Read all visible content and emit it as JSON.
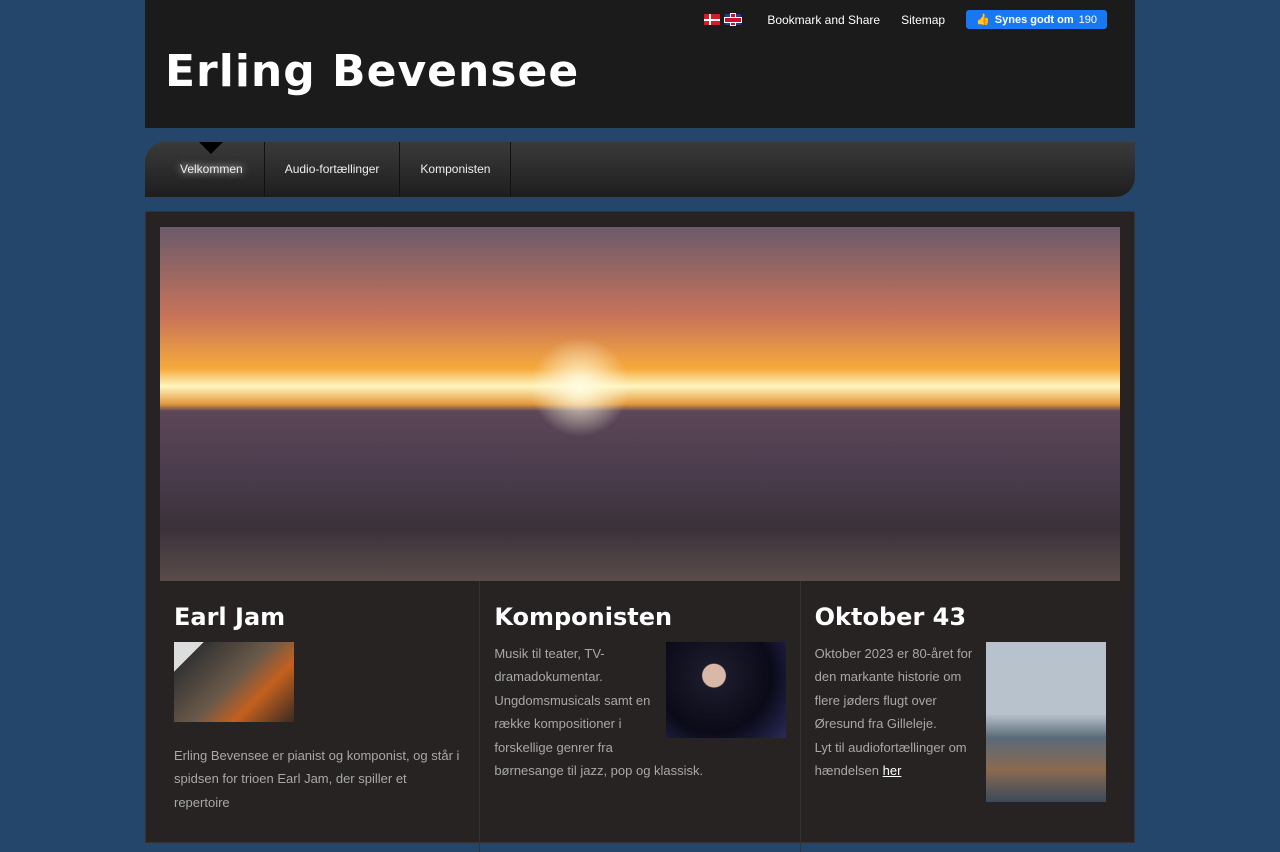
{
  "header": {
    "title": "Erling Bevensee",
    "bookmark": "Bookmark and Share",
    "sitemap": "Sitemap",
    "fb_label": "Synes godt om",
    "fb_count": "190"
  },
  "nav": [
    {
      "label": "Velkommen"
    },
    {
      "label": "Audio-fortællinger"
    },
    {
      "label": "Komponisten"
    }
  ],
  "columns": [
    {
      "title": "Earl Jam",
      "text": "Erling Bevensee er pianist og komponist, og står i spidsen for trioen Earl Jam, der spiller et repertoire"
    },
    {
      "title": "Komponisten",
      "text": "Musik til teater, TV-dramadokumentar. Ungdomsmusicals samt en række kompositioner i forskellige genrer fra børnesange til jazz, pop og klassisk."
    },
    {
      "title": "Oktober 43",
      "text": " Oktober 2023 er 80-året for den markante historie om flere jøders flugt over Øresund fra Gilleleje.",
      "text2": "Lyt til audiofortællinger om hændelsen ",
      "link": "her"
    }
  ]
}
